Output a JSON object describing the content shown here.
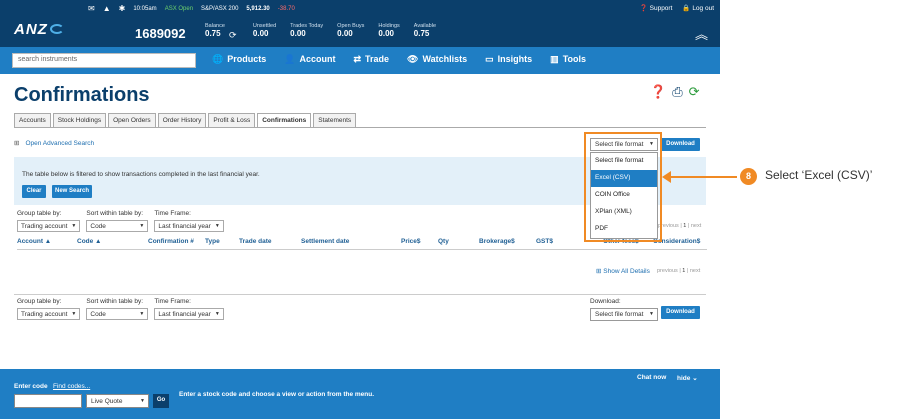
{
  "topbar": {
    "time": "10:05am",
    "market_status": "ASX Open",
    "index_name": "S&P/ASX 200",
    "index_value": "5,912.30",
    "index_change": "-38.70",
    "support": "Support",
    "logout": "Log out",
    "logo": "ANZ",
    "account_number": "1689092",
    "stats": [
      {
        "label": "Balance",
        "value": "0.75"
      },
      {
        "label": "Unsettled",
        "value": "0.00"
      },
      {
        "label": "Trades Today",
        "value": "0.00"
      },
      {
        "label": "Open Buys",
        "value": "0.00"
      },
      {
        "label": "Holdings",
        "value": "0.00"
      },
      {
        "label": "Available",
        "value": "0.75"
      }
    ]
  },
  "nav": {
    "search_placeholder": "search instruments",
    "items": [
      "Products",
      "Account",
      "Trade",
      "Watchlists",
      "Insights",
      "Tools"
    ]
  },
  "page": {
    "title": "Confirmations",
    "tabs": [
      "Accounts",
      "Stock Holdings",
      "Open Orders",
      "Order History",
      "Profit & Loss",
      "Confirmations",
      "Statements"
    ],
    "active_tab": "Confirmations",
    "advanced_search": "Open Advanced Search",
    "info_text": "The table below is filtered to show transactions completed in the last financial year.",
    "clear_label": "Clear",
    "new_search_label": "New Search",
    "download_label": "Download",
    "download_caption": "Download:",
    "file_format_selected": "Select file format",
    "filters": {
      "group_label": "Group table by:",
      "group_value": "Trading account",
      "sort_label": "Sort within table by:",
      "sort_value": "Code",
      "time_label": "Time Frame:",
      "time_value": "Last financial year"
    },
    "columns": [
      "Account ▲",
      "Code ▲",
      "Confirmation #",
      "Type",
      "Trade date",
      "Settlement date",
      "Price$",
      "Qty",
      "Brokerage$",
      "GST$",
      "Other fees$",
      "Consideration$"
    ],
    "pager_prev": "previous",
    "pager_page": "1",
    "pager_next": "next",
    "show_all": "Show All Details"
  },
  "dropdown": {
    "options": [
      "Select file format",
      "Excel (CSV)",
      "COIN Office",
      "XPlan (XML)",
      "PDF"
    ],
    "selected_index": 1
  },
  "footer": {
    "enter_code": "Enter code",
    "find_codes": "Find codes...",
    "quote_select": "Live Quote",
    "go": "Go",
    "hint": "Enter a stock code and choose a view or action from the menu.",
    "chat": "Chat now",
    "hide": "hide"
  },
  "annotation": {
    "step_number": "8",
    "step_text": "Select ‘Excel (CSV)’",
    "color": "#f08a24"
  }
}
